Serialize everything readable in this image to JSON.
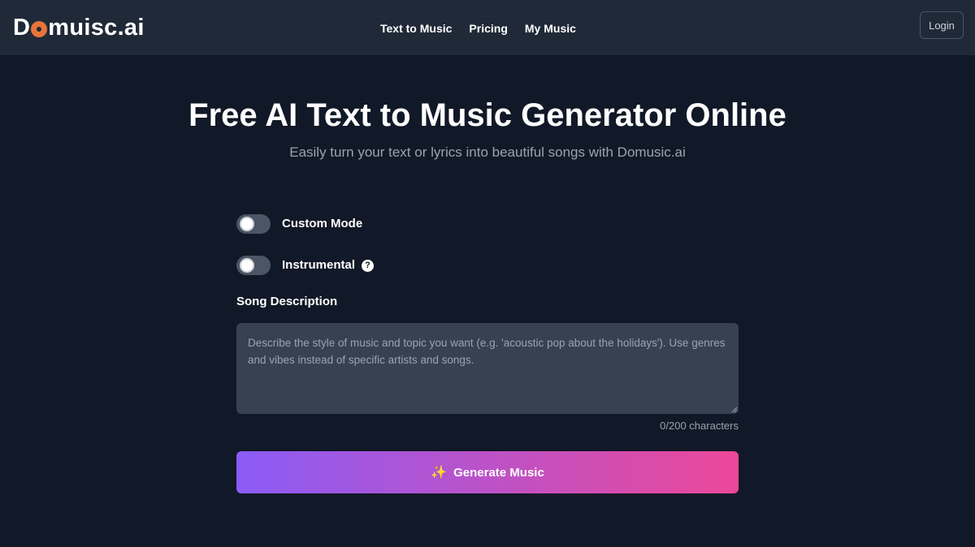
{
  "header": {
    "logo_prefix": "D",
    "logo_suffix": "muisc.ai",
    "nav": {
      "text_to_music": "Text to Music",
      "pricing": "Pricing",
      "my_music": "My Music"
    },
    "login_label": "Login"
  },
  "hero": {
    "title": "Free AI Text to Music Generator Online",
    "subtitle": "Easily turn your text or lyrics into beautiful songs with Domusic.ai"
  },
  "form": {
    "custom_mode_label": "Custom Mode",
    "custom_mode_on": false,
    "instrumental_label": "Instrumental",
    "instrumental_on": false,
    "help_icon": "question-circle-icon",
    "description_label": "Song Description",
    "description_value": "",
    "description_placeholder": "Describe the style of music and topic you want (e.g. 'acoustic pop about the holidays'). Use genres and vibes instead of specific artists and songs.",
    "char_count": "0/200 characters",
    "generate_icon": "sparkles-icon",
    "generate_label": "Generate Music"
  },
  "colors": {
    "background": "#111827",
    "header": "#1f2937",
    "accent_logo": "#e8743b",
    "button_gradient_start": "#8b5cf6",
    "button_gradient_end": "#ec4899",
    "input_bg": "#374151"
  }
}
